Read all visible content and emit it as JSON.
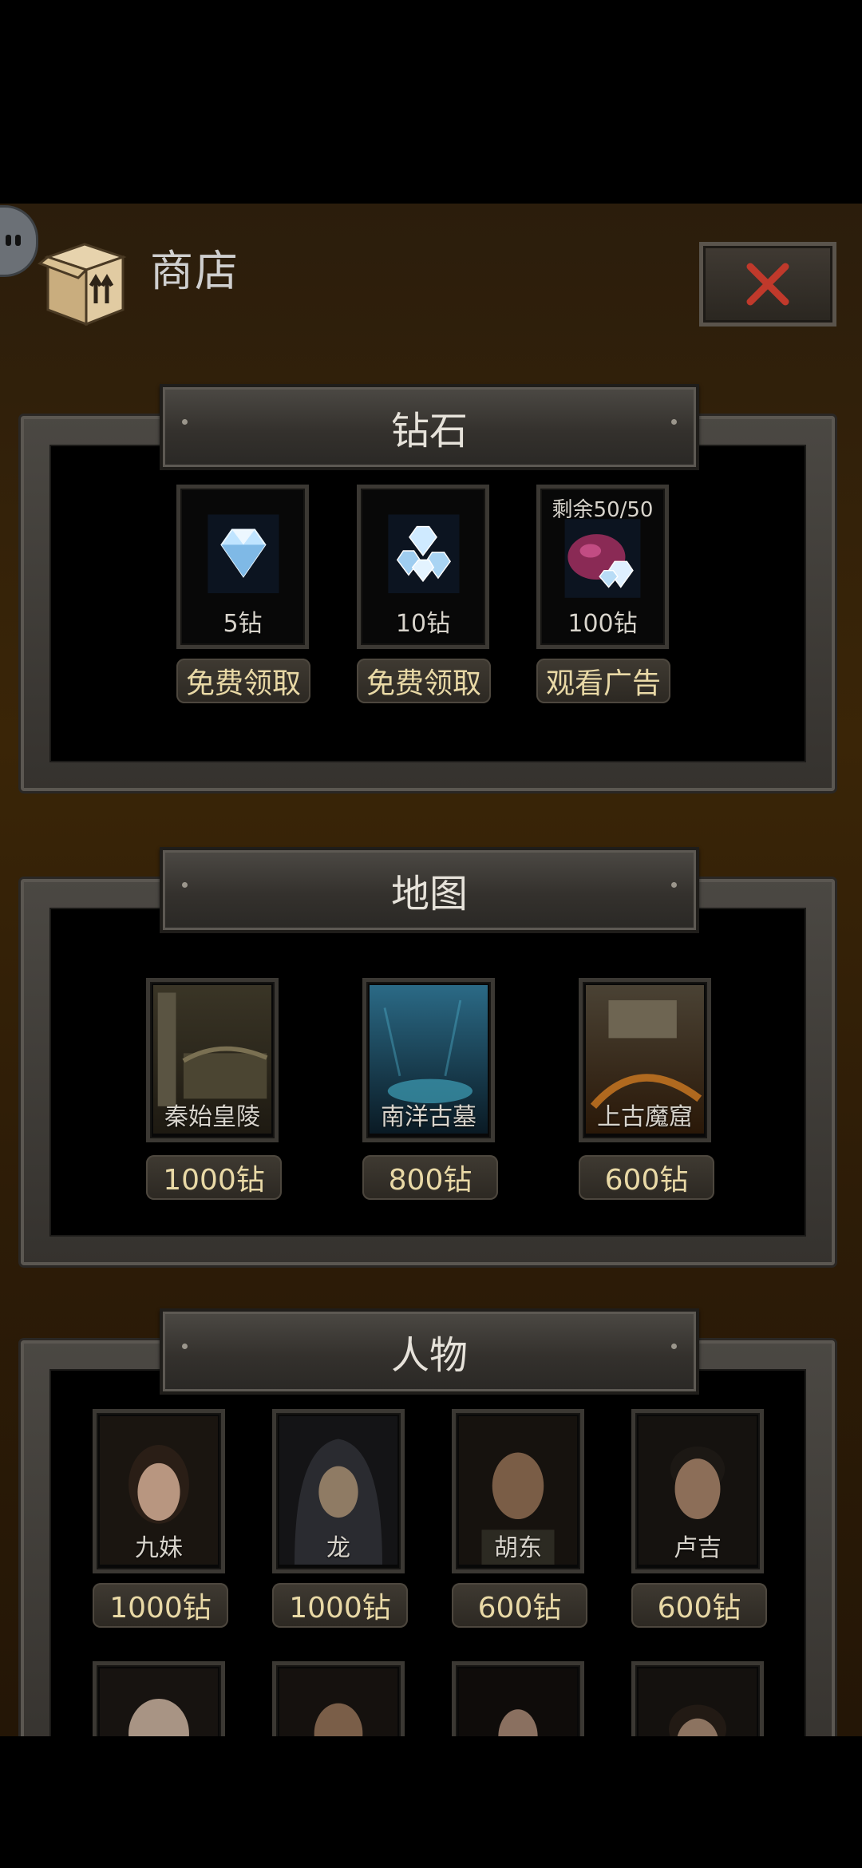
{
  "header": {
    "title": "商店"
  },
  "sections": {
    "diamond": {
      "title": "钻石",
      "items": [
        {
          "label": "5钻",
          "button": "免费领取",
          "icon": "diamond-single-icon"
        },
        {
          "label": "10钻",
          "button": "免费领取",
          "icon": "diamond-pile-icon"
        },
        {
          "label": "100钻",
          "button": "观看广告",
          "remaining": "剩余50/50",
          "icon": "diamond-bag-icon"
        }
      ]
    },
    "map": {
      "title": "地图",
      "items": [
        {
          "label": "秦始皇陵",
          "price": "1000钻"
        },
        {
          "label": "南洋古墓",
          "price": "800钻"
        },
        {
          "label": "上古魔窟",
          "price": "600钻"
        }
      ]
    },
    "character": {
      "title": "人物",
      "items": [
        {
          "label": "九妹",
          "price": "1000钻"
        },
        {
          "label": "龙",
          "price": "1000钻"
        },
        {
          "label": "胡东",
          "price": "600钻"
        },
        {
          "label": "卢吉",
          "price": "600钻"
        }
      ]
    }
  },
  "colors": {
    "accent_text": "#e9d9a6",
    "close_x": "#c0392b"
  }
}
